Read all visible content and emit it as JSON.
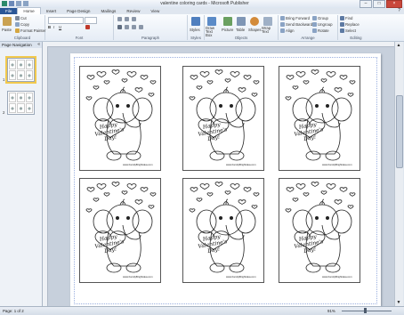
{
  "window": {
    "title": "valentine coloring cards - Microsoft Publisher",
    "controls": {
      "minimize": "–",
      "maximize": "□",
      "close": "×"
    }
  },
  "tabs": [
    "File",
    "Home",
    "Insert",
    "Page Design",
    "Mailings",
    "Review",
    "View"
  ],
  "active_tab": "Home",
  "ribbon": {
    "clipboard": {
      "label": "Clipboard",
      "paste": "Paste",
      "cut": "Cut",
      "copy": "Copy",
      "format_painter": "Format Painter"
    },
    "font": {
      "label": "Font"
    },
    "paragraph": {
      "label": "Paragraph"
    },
    "styles": {
      "label": "Styles",
      "button": "Styles"
    },
    "objects": {
      "label": "Objects",
      "draw_text_box": "Draw Text Box",
      "picture": "Picture",
      "table": "Table",
      "shapes": "Shapes",
      "wrap_text": "Wrap Text"
    },
    "arrange": {
      "label": "Arrange",
      "bring_forward": "Bring Forward",
      "send_backward": "Send Backward",
      "align": "Align",
      "group": "Group",
      "ungroup": "Ungroup",
      "rotate": "Rotate"
    },
    "editing": {
      "label": "Editing",
      "find": "Find",
      "replace": "Replace",
      "select": "Select"
    }
  },
  "nav_pane": {
    "title": "Page Navigation",
    "collapse": "«",
    "pages": [
      {
        "number": "1",
        "selected": true
      },
      {
        "number": "2",
        "selected": false
      }
    ]
  },
  "card": {
    "message": "Happy Valentine's Day!",
    "url": "www.FamilyBrightidea.com"
  },
  "status": {
    "page": "Page: 1 of 2",
    "zoom": "91%"
  },
  "colors": {
    "file_tab": "#2b5797",
    "selection": "#f2c94c",
    "workspace": "#c7d0dc"
  }
}
